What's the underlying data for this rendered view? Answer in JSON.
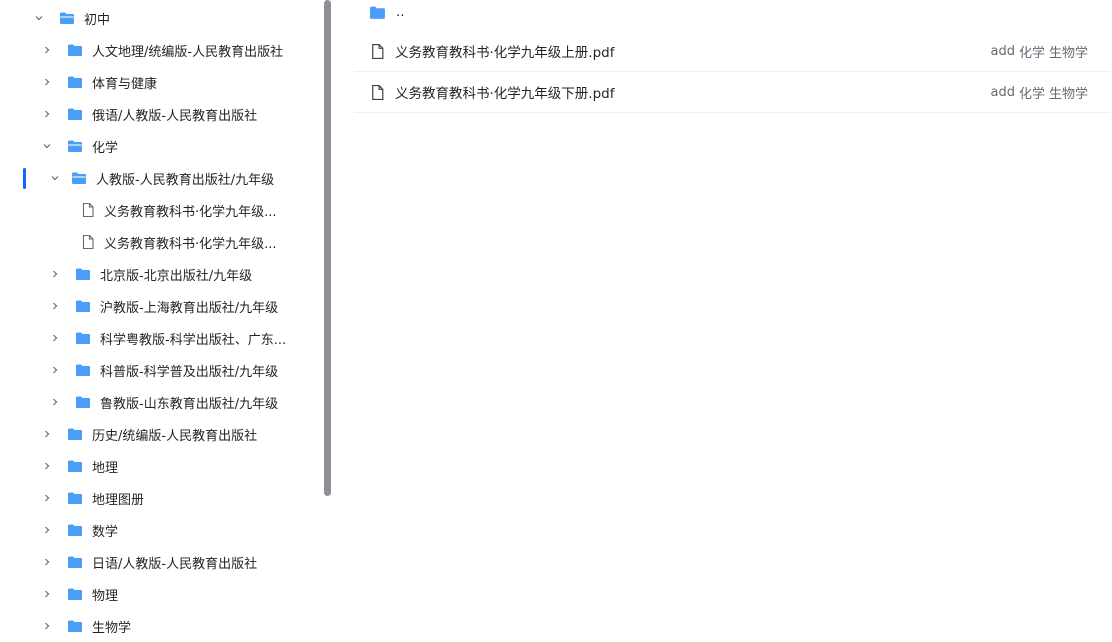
{
  "sidebar": {
    "items": [
      {
        "label": "初中",
        "type": "folder",
        "expanded": true
      },
      {
        "label": "人文地理/统编版-人民教育出版社",
        "type": "folder"
      },
      {
        "label": "体育与健康",
        "type": "folder"
      },
      {
        "label": "俄语/人教版-人民教育出版社",
        "type": "folder"
      },
      {
        "label": "化学",
        "type": "folder",
        "expanded": true
      },
      {
        "label": "人教版-人民教育出版社/九年级",
        "type": "folder",
        "expanded": true,
        "active": true
      },
      {
        "label": "义务教育教科书·化学九年级...",
        "type": "file"
      },
      {
        "label": "义务教育教科书·化学九年级...",
        "type": "file"
      },
      {
        "label": "北京版-北京出版社/九年级",
        "type": "folder"
      },
      {
        "label": "沪教版-上海教育出版社/九年级",
        "type": "folder"
      },
      {
        "label": "科学粤教版-科学出版社、广东...",
        "type": "folder"
      },
      {
        "label": "科普版-科学普及出版社/九年级",
        "type": "folder"
      },
      {
        "label": "鲁教版-山东教育出版社/九年级",
        "type": "folder"
      },
      {
        "label": "历史/统编版-人民教育出版社",
        "type": "folder"
      },
      {
        "label": "地理",
        "type": "folder"
      },
      {
        "label": "地理图册",
        "type": "folder"
      },
      {
        "label": "数学",
        "type": "folder"
      },
      {
        "label": "日语/人教版-人民教育出版社",
        "type": "folder"
      },
      {
        "label": "物理",
        "type": "folder"
      },
      {
        "label": "生物学",
        "type": "folder"
      }
    ]
  },
  "main": {
    "parent_label": "..",
    "files": [
      {
        "name": "义务教育教科书·化学九年级上册.pdf",
        "tags": [
          "add",
          "化学",
          "生物学"
        ]
      },
      {
        "name": "义务教育教科书·化学九年级下册.pdf",
        "tags": [
          "add",
          "化学",
          "生物学"
        ]
      }
    ]
  },
  "colors": {
    "folder": "#4a9df8",
    "accent": "#1664ff",
    "scrollbar": "#8c8f94",
    "tag_text": "#646a73"
  },
  "icons": {
    "folder": "folder-icon",
    "folder_open": "folder-open-icon",
    "file": "file-icon",
    "chevron_right": "chevron-right-icon",
    "chevron_down": "chevron-down-icon"
  }
}
